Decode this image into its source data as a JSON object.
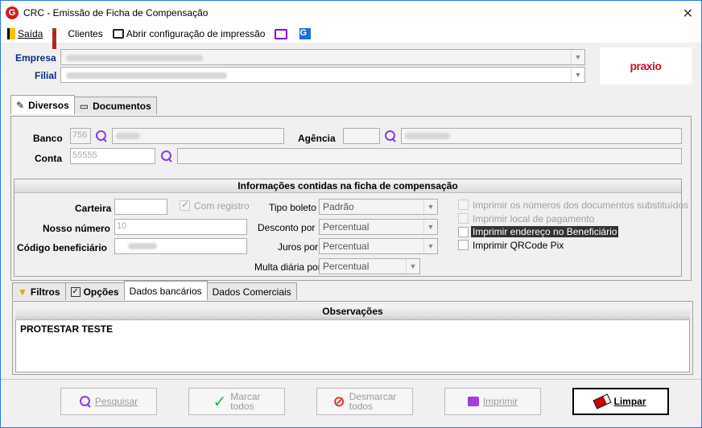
{
  "window": {
    "title": "CRC - Emissão de Ficha de Compensação",
    "close": "✕"
  },
  "menu": {
    "exit": "Saída",
    "clients": "Clientes",
    "print_config": "Abrir configuração de impressão"
  },
  "header": {
    "empresa_label": "Empresa",
    "filial_label": "Filial",
    "brand_logo": "praxio"
  },
  "top_tabs": [
    {
      "label": "Diversos",
      "active": true
    },
    {
      "label": "Documentos",
      "active": false
    }
  ],
  "bank": {
    "banco_label": "Banco",
    "banco_value": "756",
    "agencia_label": "Agência",
    "conta_label": "Conta",
    "conta_value": "55555"
  },
  "info_group": {
    "title": "Informações contidas na ficha de compensação",
    "carteira_label": "Carteira",
    "com_registro_label": "Com registro",
    "nosso_numero_label": "Nosso número",
    "nosso_numero_value": "10",
    "codigo_beneficiario_label": "Código beneficiário",
    "tipo_boleto_label": "Tipo boleto",
    "tipo_boleto_value": "Padrão",
    "desconto_label": "Desconto por",
    "desconto_value": "Percentual",
    "juros_label": "Juros por",
    "juros_value": "Percentual",
    "multa_label": "Multa diária por",
    "multa_value": "Percentual",
    "options": [
      {
        "label": "Imprimir os números dos documentos substituídos",
        "disabled": true,
        "selected": false
      },
      {
        "label": "Imprimir local de pagamento",
        "disabled": true,
        "selected": false
      },
      {
        "label": "Imprimir endereço no Beneficiário",
        "disabled": false,
        "selected": true
      },
      {
        "label": "Imprimir QRCode Pix",
        "disabled": false,
        "selected": false
      }
    ]
  },
  "bottom_tabs": [
    {
      "label": "Filtros"
    },
    {
      "label": "Opções"
    },
    {
      "label": "Dados bancários"
    },
    {
      "label": "Dados Comerciais"
    }
  ],
  "observacoes": {
    "title": "Observações",
    "text": "PROTESTAR TESTE"
  },
  "buttons": {
    "pesquisar": "Pesquisar",
    "marcar_line1": "Marcar",
    "marcar_line2": "todos",
    "desmarcar_line1": "Desmarcar",
    "desmarcar_line2": "todos",
    "imprimir": "Imprimir",
    "limpar": "Limpar"
  },
  "colors": {
    "accent": "#8a3ddf",
    "brand": "#c8102e",
    "label_blue": "#0a2a8a"
  }
}
